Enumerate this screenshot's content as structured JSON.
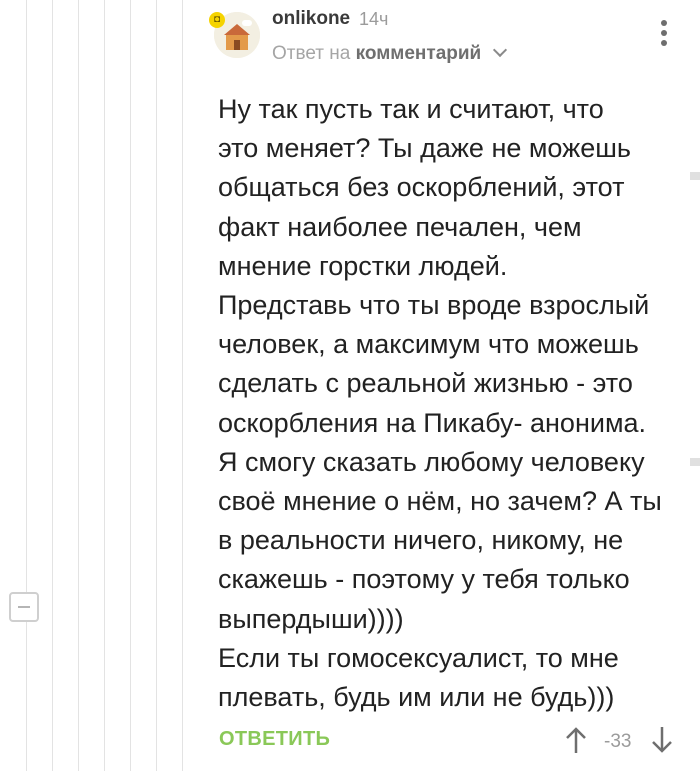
{
  "comment": {
    "author": "onlikone",
    "time": "14ч",
    "reply_prefix": "Ответ на",
    "reply_target": "комментарий",
    "text": "Ну так пусть так и считают, что\nэто меняет? Ты даже не можешь\nобщаться без оскорблений, этот\nфакт наиболее печален, чем\nмнение горстки людей.\nПредставь что ты вроде взрослый\nчеловек, а максимум что можешь\nсделать с реальной жизнью - это\nоскорбления на Пикабу- анонима.\nЯ смогу сказать любому человеку\nсвоё мнение о нём, но зачем? А ты\nв реальности ничего, никому, не\nскажешь - поэтому у тебя только\nвыпердыши))))\nЕсли ты гомосексуалист, то мне\nплевать, будь им или не будь)))",
    "reply_label": "ОТВЕТИТЬ",
    "rating": "-33"
  },
  "colors": {
    "accent_green": "#8ac858",
    "badge_yellow": "#f5d300",
    "text": "#222222",
    "muted": "#9b9b9b"
  },
  "icons": {
    "avatar_badge": "pikabu-badge-icon",
    "more": "more-vertical-icon",
    "upvote": "arrow-up-icon",
    "downvote": "arrow-down-icon",
    "collapse": "collapse-minus-icon"
  }
}
